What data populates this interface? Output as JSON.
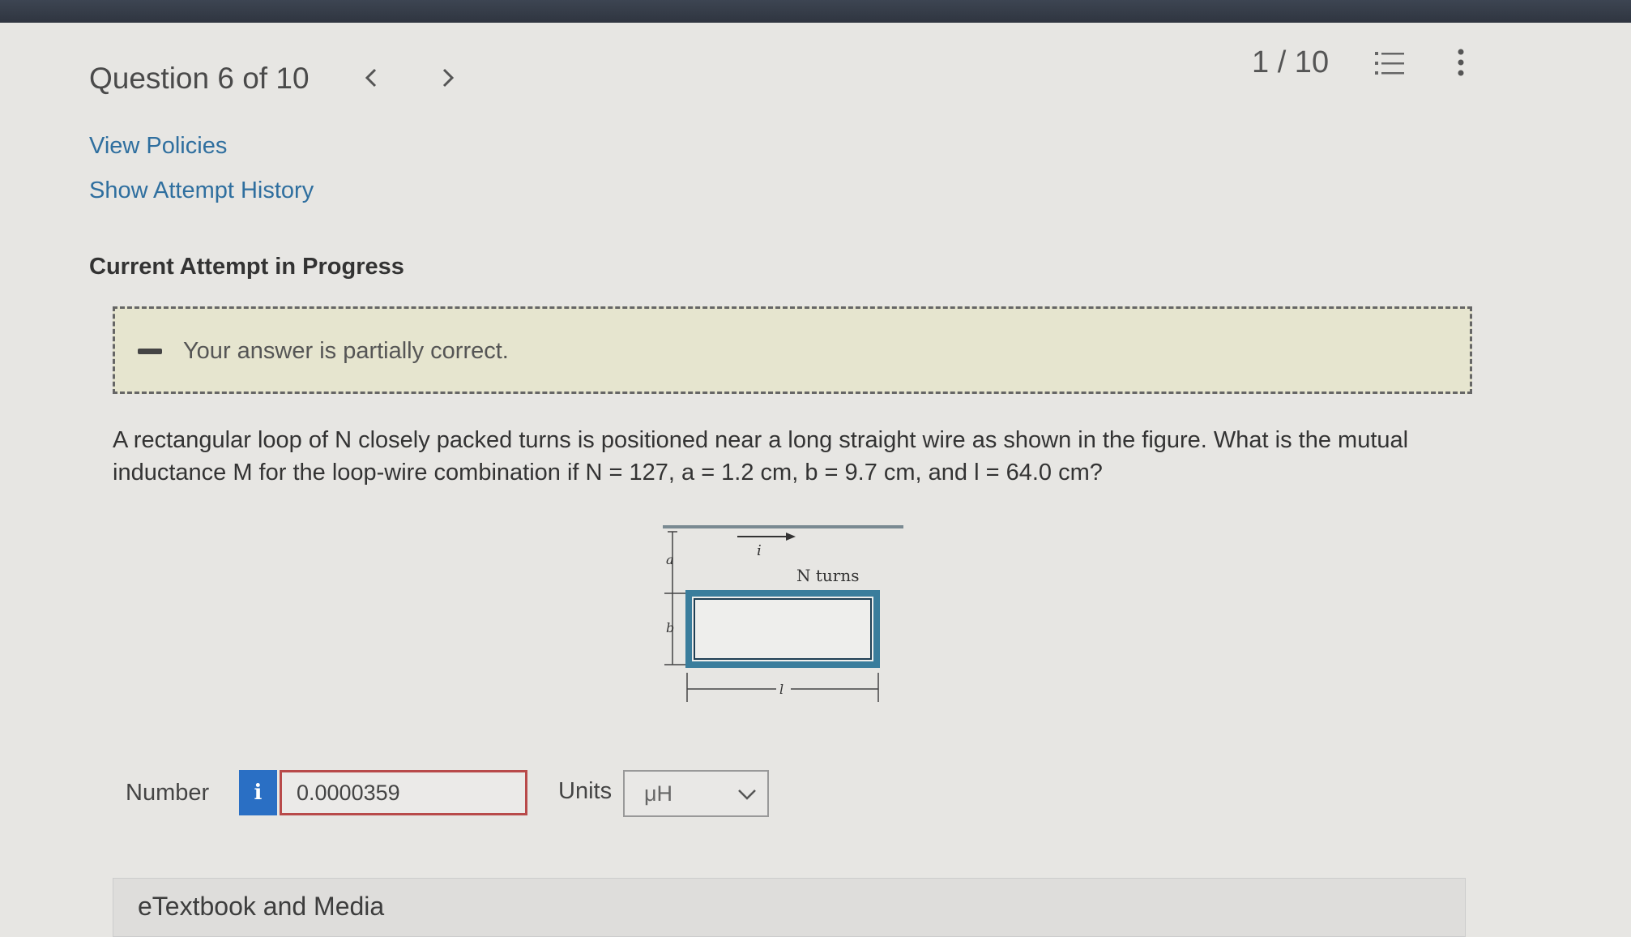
{
  "header": {
    "question_title": "Question 6 of 10",
    "prev_label": "<",
    "next_label": ">",
    "score": "1 / 10"
  },
  "links": {
    "view_policies": "View Policies",
    "show_attempt_history": "Show Attempt History"
  },
  "attempt_heading": "Current Attempt in Progress",
  "feedback": {
    "message": "Your answer is partially correct.",
    "background_color": "#e6e5cf"
  },
  "question": {
    "text": "A rectangular loop of N closely packed turns is positioned near a long straight wire as shown in the figure. What is the mutual inductance M for the loop-wire combination if N = 127, a = 1.2 cm, b = 9.7 cm, and l = 64.0 cm?"
  },
  "figure": {
    "current_label": "i",
    "turns_label": "N turns",
    "a_label": "a",
    "b_label": "b",
    "l_label": "l",
    "loop_color": "#3a7d9c"
  },
  "answer": {
    "number_label": "Number",
    "info_label": "i",
    "value": "0.0000359",
    "units_label": "Units",
    "units_value": "μH",
    "error_border_color": "#b84a4a",
    "info_button_color": "#2a6fc4"
  },
  "etextbook_label": "eTextbook and Media",
  "icons": {
    "prev": "chevron-left-icon",
    "next": "chevron-right-icon",
    "list": "list-icon",
    "more": "more-vertical-icon",
    "feedback": "minus-icon",
    "dropdown": "chevron-down-icon"
  }
}
